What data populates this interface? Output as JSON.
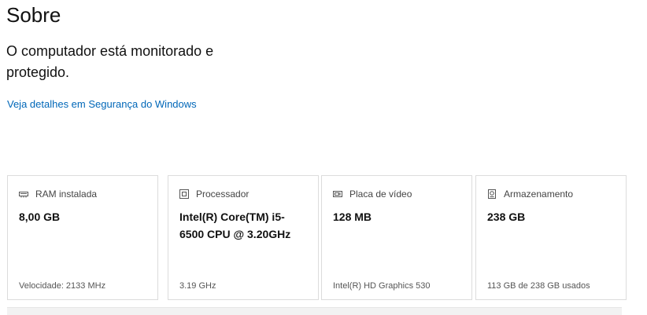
{
  "header": {
    "title": "Sobre"
  },
  "security": {
    "status_text": "O computador está monitorado e protegido.",
    "link_label": "Veja detalhes em Segurança do Windows"
  },
  "cards": [
    {
      "icon": "ram-icon",
      "label": "RAM instalada",
      "value": "8,00 GB",
      "detail": "Velocidade: 2133 MHz"
    },
    {
      "icon": "processor-icon",
      "label": "Processador",
      "value": "Intel(R) Core(TM) i5-6500 CPU @ 3.20GHz",
      "detail": "3.19 GHz"
    },
    {
      "icon": "graphics-card-icon",
      "label": "Placa de vídeo",
      "value": "128 MB",
      "detail": "Intel(R) HD Graphics 530"
    },
    {
      "icon": "storage-icon",
      "label": "Armazenamento",
      "value": "238 GB",
      "detail": "113 GB de 238 GB usados"
    }
  ],
  "colors": {
    "link": "#0067b8",
    "card_border": "#dcdcdc"
  }
}
